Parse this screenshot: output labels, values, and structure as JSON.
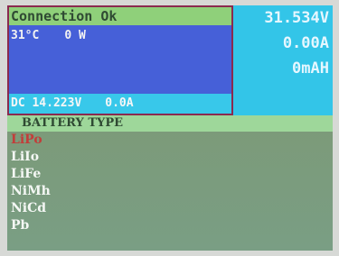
{
  "status": {
    "title": "Connection Ok",
    "temperature": "31°C",
    "power": "0 W",
    "dc_voltage": "DC 14.223V",
    "dc_current": "0.0A"
  },
  "readouts": {
    "voltage": "31.534V",
    "current": "0.00A",
    "capacity": "0mAH"
  },
  "battery": {
    "header": "BATTERY TYPE",
    "items": [
      "LiPo",
      "LiIo",
      "LiFe",
      "NiMh",
      "NiCd",
      "Pb"
    ],
    "selected": "LiPo"
  },
  "colors": {
    "status_header_bg": "#8fd07a",
    "status_panel_bg": "#4660d8",
    "cyan_panel_bg": "#33c5e8",
    "selected_text": "#c23d3a"
  }
}
